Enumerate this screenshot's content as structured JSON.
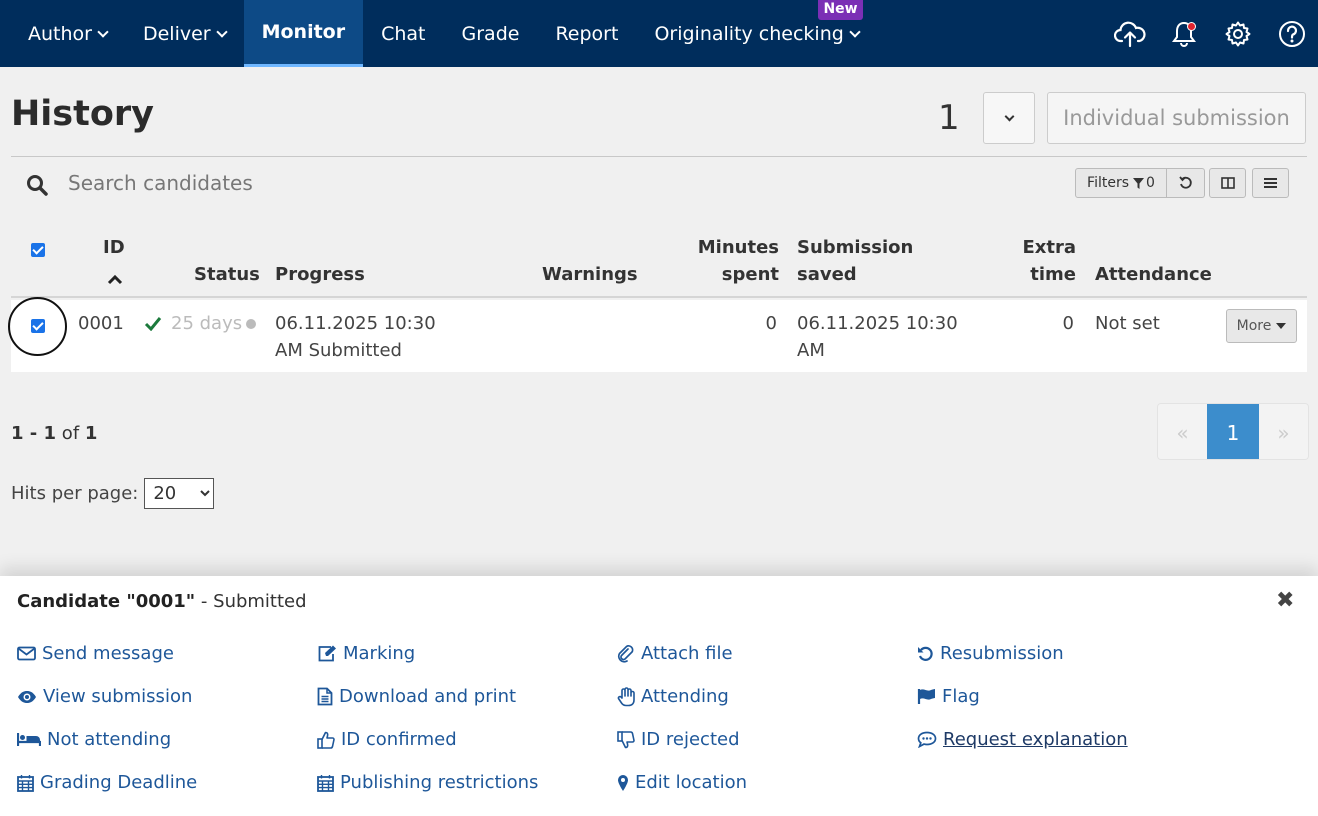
{
  "nav": {
    "items": [
      {
        "label": "Author",
        "has_dropdown": true
      },
      {
        "label": "Deliver",
        "has_dropdown": true
      },
      {
        "label": "Monitor",
        "active": true
      },
      {
        "label": "Chat"
      },
      {
        "label": "Grade"
      },
      {
        "label": "Report"
      },
      {
        "label": "Originality checking",
        "has_dropdown": true
      }
    ],
    "new_badge": "New",
    "icons": [
      "upload-icon",
      "bell-icon",
      "gear-icon",
      "help-icon"
    ],
    "colors": {
      "bar": "#002d5c",
      "active": "#0d4a86",
      "badge": "#7b2fb5",
      "notification": "#e2242f"
    }
  },
  "history": {
    "title": "History",
    "count": "1",
    "individual_submission_label": "Individual submission"
  },
  "search": {
    "placeholder": "Search candidates",
    "filters_label": "Filters",
    "filters_count": "0"
  },
  "table": {
    "headers": {
      "id": "ID",
      "status": "Status",
      "progress": "Progress",
      "warnings": "Warnings",
      "minutes_1": "Minutes",
      "minutes_2": "spent",
      "saved_1": "Submission",
      "saved_2": "saved",
      "extra_1": "Extra",
      "extra_2": "time",
      "attendance": "Attendance"
    },
    "rows": [
      {
        "id": "0001",
        "status_text": "25 days",
        "progress_1": "06.11.2025 10:30",
        "progress_2": "AM Submitted",
        "warnings": "",
        "minutes": "0",
        "saved_1": "06.11.2025 10:30",
        "saved_2": "AM",
        "extra": "0",
        "attendance": "Not set",
        "more_label": "More"
      }
    ]
  },
  "paging": {
    "range_start": "1",
    "range_sep": " - ",
    "range_end": "1",
    "of": " of ",
    "total": "1",
    "hits_label": "Hits per page:",
    "hits_value": "20",
    "prev": "«",
    "current": "1",
    "next": "»"
  },
  "panel": {
    "candidate_label": "Candidate \"0001\"",
    "status_suffix": " - Submitted",
    "actions": [
      {
        "label": "Send message",
        "icon": "envelope-icon"
      },
      {
        "label": "Marking",
        "icon": "edit-icon"
      },
      {
        "label": "Attach file",
        "icon": "paperclip-icon"
      },
      {
        "label": "Resubmission",
        "icon": "undo-icon"
      },
      {
        "label": "View submission",
        "icon": "eye-icon"
      },
      {
        "label": "Download and print",
        "icon": "file-icon"
      },
      {
        "label": "Attending",
        "icon": "hand-icon"
      },
      {
        "label": "Flag",
        "icon": "flag-icon"
      },
      {
        "label": "Not attending",
        "icon": "bed-icon"
      },
      {
        "label": "ID confirmed",
        "icon": "thumbs-up-icon"
      },
      {
        "label": "ID rejected",
        "icon": "thumbs-down-icon"
      },
      {
        "label": "Request explanation",
        "icon": "comment-icon"
      },
      {
        "label": "Grading Deadline",
        "icon": "calendar-icon"
      },
      {
        "label": "Publishing restrictions",
        "icon": "calendar-icon"
      },
      {
        "label": "Edit location",
        "icon": "map-marker-icon"
      }
    ]
  }
}
